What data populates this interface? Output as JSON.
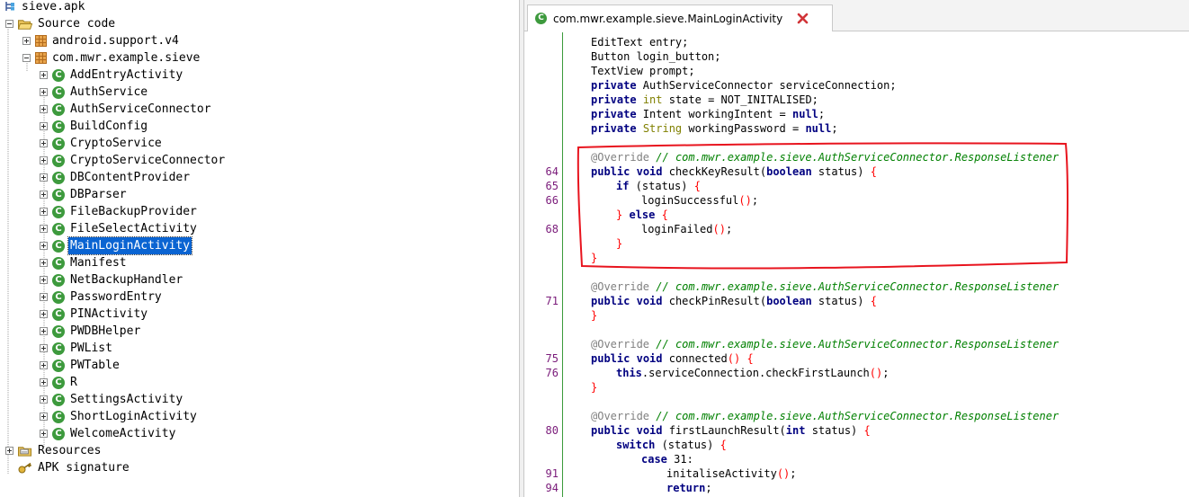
{
  "tree": {
    "rows": [
      {
        "label": "sieve.apk",
        "icon": "apk-icon",
        "expander": "none",
        "indent": 0
      },
      {
        "label": "Source code",
        "icon": "folder-icon",
        "expander": "minus",
        "indent": 1
      },
      {
        "label": "android.support.v4",
        "icon": "package-icon",
        "expander": "plus",
        "indent": 2
      },
      {
        "label": "com.mwr.example.sieve",
        "icon": "package-icon",
        "expander": "minus",
        "indent": 2
      },
      {
        "label": "AddEntryActivity",
        "icon": "class-icon",
        "expander": "plus",
        "indent": 3
      },
      {
        "label": "AuthService",
        "icon": "class-icon",
        "expander": "plus",
        "indent": 3
      },
      {
        "label": "AuthServiceConnector",
        "icon": "class-icon",
        "expander": "plus",
        "indent": 3
      },
      {
        "label": "BuildConfig",
        "icon": "class-icon",
        "expander": "plus",
        "indent": 3
      },
      {
        "label": "CryptoService",
        "icon": "class-icon",
        "expander": "plus",
        "indent": 3
      },
      {
        "label": "CryptoServiceConnector",
        "icon": "class-icon",
        "expander": "plus",
        "indent": 3
      },
      {
        "label": "DBContentProvider",
        "icon": "class-icon",
        "expander": "plus",
        "indent": 3
      },
      {
        "label": "DBParser",
        "icon": "class-icon",
        "expander": "plus",
        "indent": 3
      },
      {
        "label": "FileBackupProvider",
        "icon": "class-icon",
        "expander": "plus",
        "indent": 3
      },
      {
        "label": "FileSelectActivity",
        "icon": "class-icon",
        "expander": "plus",
        "indent": 3
      },
      {
        "label": "MainLoginActivity",
        "icon": "class-icon",
        "expander": "plus",
        "indent": 3,
        "selected": true
      },
      {
        "label": "Manifest",
        "icon": "class-icon",
        "expander": "plus",
        "indent": 3
      },
      {
        "label": "NetBackupHandler",
        "icon": "class-icon",
        "expander": "plus",
        "indent": 3
      },
      {
        "label": "PasswordEntry",
        "icon": "class-icon",
        "expander": "plus",
        "indent": 3
      },
      {
        "label": "PINActivity",
        "icon": "class-icon",
        "expander": "plus",
        "indent": 3
      },
      {
        "label": "PWDBHelper",
        "icon": "class-icon",
        "expander": "plus",
        "indent": 3
      },
      {
        "label": "PWList",
        "icon": "class-icon",
        "expander": "plus",
        "indent": 3
      },
      {
        "label": "PWTable",
        "icon": "class-icon",
        "expander": "plus",
        "indent": 3
      },
      {
        "label": "R",
        "icon": "class-icon",
        "expander": "plus",
        "indent": 3
      },
      {
        "label": "SettingsActivity",
        "icon": "class-icon",
        "expander": "plus",
        "indent": 3
      },
      {
        "label": "ShortLoginActivity",
        "icon": "class-icon",
        "expander": "plus",
        "indent": 3
      },
      {
        "label": "WelcomeActivity",
        "icon": "class-icon",
        "expander": "plus",
        "indent": 3
      },
      {
        "label": "Resources",
        "icon": "resources-folder-icon",
        "expander": "plus",
        "indent": 1
      },
      {
        "label": "APK signature",
        "icon": "key-icon",
        "expander": "none",
        "indent": 1
      }
    ],
    "class_icon_glyph": "C"
  },
  "editor": {
    "tab_title": "com.mwr.example.sieve.MainLoginActivity",
    "tab_icon_glyph": "C",
    "close_glyph": "✖",
    "colors": {
      "keyword": "#000080",
      "type": "#808000",
      "annotation": "#808080",
      "comment": "#008000",
      "bracket": "#ff0000",
      "line_number": "#7a1b7a",
      "highlight_stroke": "#e8141e"
    },
    "lines": [
      {
        "no": "",
        "indent": 0,
        "tokens": [
          [
            "p",
            "EditText entry;"
          ]
        ]
      },
      {
        "no": "",
        "indent": 0,
        "tokens": [
          [
            "p",
            "Button login_button;"
          ]
        ]
      },
      {
        "no": "",
        "indent": 0,
        "tokens": [
          [
            "p",
            "TextView prompt;"
          ]
        ]
      },
      {
        "no": "",
        "indent": 0,
        "tokens": [
          [
            "kw",
            "private"
          ],
          [
            "p",
            " AuthServiceConnector serviceConnection;"
          ]
        ]
      },
      {
        "no": "",
        "indent": 0,
        "tokens": [
          [
            "kw",
            "private"
          ],
          [
            "p",
            " "
          ],
          [
            "ty",
            "int"
          ],
          [
            "p",
            " state = NOT_INITALISED;"
          ]
        ]
      },
      {
        "no": "",
        "indent": 0,
        "tokens": [
          [
            "kw",
            "private"
          ],
          [
            "p",
            " Intent workingIntent = "
          ],
          [
            "kw",
            "null"
          ],
          [
            "p",
            ";"
          ]
        ]
      },
      {
        "no": "",
        "indent": 0,
        "tokens": [
          [
            "kw",
            "private"
          ],
          [
            "p",
            " "
          ],
          [
            "ty",
            "String"
          ],
          [
            "p",
            " workingPassword = "
          ],
          [
            "kw",
            "null"
          ],
          [
            "p",
            ";"
          ]
        ]
      },
      {
        "no": "",
        "indent": 0,
        "tokens": []
      },
      {
        "no": "",
        "indent": 0,
        "tokens": [
          [
            "an",
            "@Override"
          ],
          [
            "p",
            " "
          ],
          [
            "cm",
            "// com.mwr.example.sieve.AuthServiceConnector.ResponseListener"
          ]
        ]
      },
      {
        "no": "64",
        "indent": 0,
        "tokens": [
          [
            "kw",
            "public"
          ],
          [
            "p",
            " "
          ],
          [
            "kw",
            "void"
          ],
          [
            "p",
            " checkKeyResult("
          ],
          [
            "kw",
            "boolean"
          ],
          [
            "p",
            " status) "
          ],
          [
            "br",
            "{"
          ]
        ]
      },
      {
        "no": "65",
        "indent": 1,
        "tokens": [
          [
            "kw",
            "if"
          ],
          [
            "p",
            " (status) "
          ],
          [
            "br",
            "{"
          ]
        ]
      },
      {
        "no": "66",
        "indent": 2,
        "tokens": [
          [
            "p",
            "loginSuccessful"
          ],
          [
            "br",
            "()"
          ],
          [
            "p",
            ";"
          ]
        ]
      },
      {
        "no": "",
        "indent": 1,
        "tokens": [
          [
            "br",
            "}"
          ],
          [
            "p",
            " "
          ],
          [
            "kw",
            "else"
          ],
          [
            "p",
            " "
          ],
          [
            "br",
            "{"
          ]
        ]
      },
      {
        "no": "68",
        "indent": 2,
        "tokens": [
          [
            "p",
            "loginFailed"
          ],
          [
            "br",
            "()"
          ],
          [
            "p",
            ";"
          ]
        ]
      },
      {
        "no": "",
        "indent": 1,
        "tokens": [
          [
            "br",
            "}"
          ]
        ]
      },
      {
        "no": "",
        "indent": 0,
        "tokens": [
          [
            "br",
            "}"
          ]
        ]
      },
      {
        "no": "",
        "indent": 0,
        "tokens": []
      },
      {
        "no": "",
        "indent": 0,
        "tokens": [
          [
            "an",
            "@Override"
          ],
          [
            "p",
            " "
          ],
          [
            "cm",
            "// com.mwr.example.sieve.AuthServiceConnector.ResponseListener"
          ]
        ]
      },
      {
        "no": "71",
        "indent": 0,
        "tokens": [
          [
            "kw",
            "public"
          ],
          [
            "p",
            " "
          ],
          [
            "kw",
            "void"
          ],
          [
            "p",
            " checkPinResult("
          ],
          [
            "kw",
            "boolean"
          ],
          [
            "p",
            " status) "
          ],
          [
            "br",
            "{"
          ]
        ]
      },
      {
        "no": "",
        "indent": 0,
        "tokens": [
          [
            "br",
            "}"
          ]
        ]
      },
      {
        "no": "",
        "indent": 0,
        "tokens": []
      },
      {
        "no": "",
        "indent": 0,
        "tokens": [
          [
            "an",
            "@Override"
          ],
          [
            "p",
            " "
          ],
          [
            "cm",
            "// com.mwr.example.sieve.AuthServiceConnector.ResponseListener"
          ]
        ]
      },
      {
        "no": "75",
        "indent": 0,
        "tokens": [
          [
            "kw",
            "public"
          ],
          [
            "p",
            " "
          ],
          [
            "kw",
            "void"
          ],
          [
            "p",
            " connected"
          ],
          [
            "br",
            "()"
          ],
          [
            "p",
            " "
          ],
          [
            "br",
            "{"
          ]
        ]
      },
      {
        "no": "76",
        "indent": 1,
        "tokens": [
          [
            "kw",
            "this"
          ],
          [
            "p",
            ".serviceConnection.checkFirstLaunch"
          ],
          [
            "br",
            "()"
          ],
          [
            "p",
            ";"
          ]
        ]
      },
      {
        "no": "",
        "indent": 0,
        "tokens": [
          [
            "br",
            "}"
          ]
        ]
      },
      {
        "no": "",
        "indent": 0,
        "tokens": []
      },
      {
        "no": "",
        "indent": 0,
        "tokens": [
          [
            "an",
            "@Override"
          ],
          [
            "p",
            " "
          ],
          [
            "cm",
            "// com.mwr.example.sieve.AuthServiceConnector.ResponseListener"
          ]
        ]
      },
      {
        "no": "80",
        "indent": 0,
        "tokens": [
          [
            "kw",
            "public"
          ],
          [
            "p",
            " "
          ],
          [
            "kw",
            "void"
          ],
          [
            "p",
            " firstLaunchResult("
          ],
          [
            "kw",
            "int"
          ],
          [
            "p",
            " status) "
          ],
          [
            "br",
            "{"
          ]
        ]
      },
      {
        "no": "",
        "indent": 1,
        "tokens": [
          [
            "kw",
            "switch"
          ],
          [
            "p",
            " (status) "
          ],
          [
            "br",
            "{"
          ]
        ]
      },
      {
        "no": "",
        "indent": 2,
        "tokens": [
          [
            "kw",
            "case"
          ],
          [
            "p",
            " 31:"
          ]
        ]
      },
      {
        "no": "91",
        "indent": 3,
        "tokens": [
          [
            "p",
            "initaliseActivity"
          ],
          [
            "br",
            "()"
          ],
          [
            "p",
            ";"
          ]
        ]
      },
      {
        "no": "94",
        "indent": 3,
        "tokens": [
          [
            "kw",
            "return"
          ],
          [
            "p",
            ";"
          ]
        ]
      }
    ]
  }
}
